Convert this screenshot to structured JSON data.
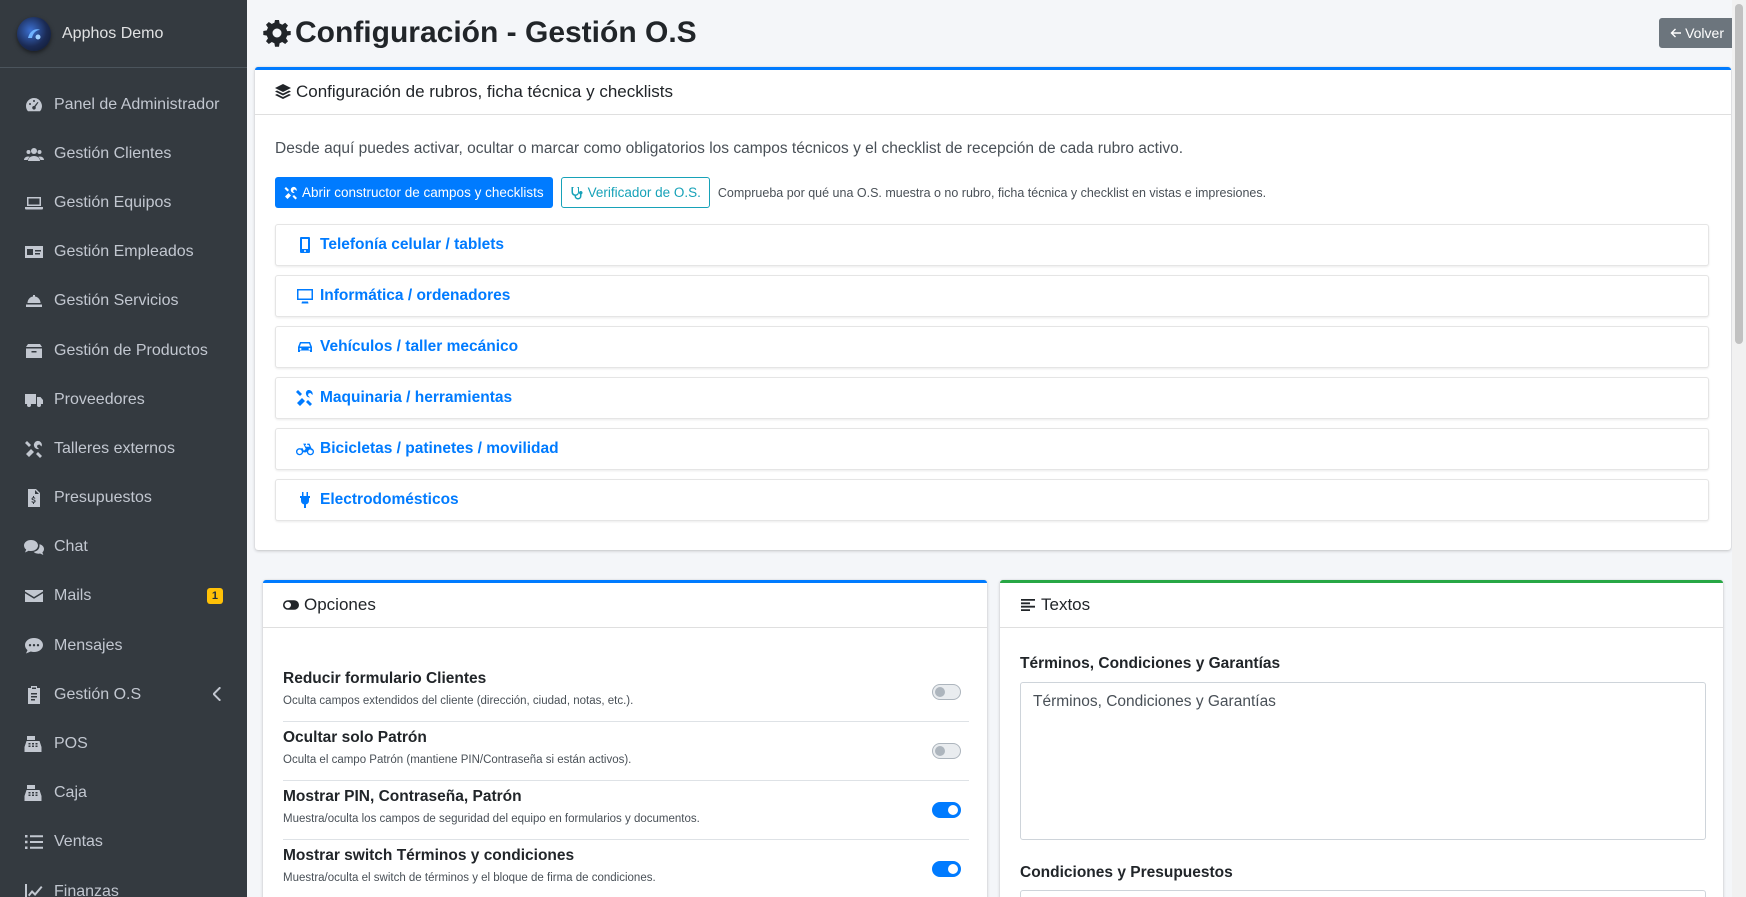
{
  "brand": {
    "name": "Apphos Demo"
  },
  "sidebar": {
    "items": [
      {
        "label": "Panel de Administrador",
        "icon": "tachometer-icon"
      },
      {
        "label": "Gestión Clientes",
        "icon": "users-icon"
      },
      {
        "label": "Gestión Equipos",
        "icon": "laptop-icon"
      },
      {
        "label": "Gestión Empleados",
        "icon": "id-card-icon"
      },
      {
        "label": "Gestión Servicios",
        "icon": "concierge-bell-icon"
      },
      {
        "label": "Gestión de Productos",
        "icon": "box-icon"
      },
      {
        "label": "Proveedores",
        "icon": "truck-icon"
      },
      {
        "label": "Talleres externos",
        "icon": "tools-icon"
      },
      {
        "label": "Presupuestos",
        "icon": "file-invoice-icon"
      },
      {
        "label": "Chat",
        "icon": "comments-icon"
      },
      {
        "label": "Mails",
        "icon": "envelope-icon",
        "badge": "1"
      },
      {
        "label": "Mensajes",
        "icon": "comment-dots-icon"
      },
      {
        "label": "Gestión O.S",
        "icon": "clipboard-icon",
        "expandable": true
      },
      {
        "label": "POS",
        "icon": "cash-register-icon"
      },
      {
        "label": "Caja",
        "icon": "cash-register-icon"
      },
      {
        "label": "Ventas",
        "icon": "list-icon"
      },
      {
        "label": "Finanzas",
        "icon": "chart-line-icon"
      }
    ]
  },
  "header": {
    "title": "Configuración - Gestión O.S",
    "back_label": "Volver"
  },
  "rubros_card": {
    "title": "Configuración de rubros, ficha técnica y checklists",
    "intro": "Desde aquí puedes activar, ocultar o marcar como obligatorios los campos técnicos y el checklist de recepción de cada rubro activo.",
    "builder_button": "Abrir constructor de campos y checklists",
    "verifier_button": "Verificador de O.S.",
    "hint": "Comprueba por qué una O.S. muestra o no rubro, ficha técnica y checklist en vistas e impresiones.",
    "rubros": [
      {
        "label": "Telefonía celular / tablets",
        "icon": "mobile-icon"
      },
      {
        "label": "Informática / ordenadores",
        "icon": "desktop-icon"
      },
      {
        "label": "Vehículos / taller mecánico",
        "icon": "car-icon"
      },
      {
        "label": "Maquinaria / herramientas",
        "icon": "tools-icon"
      },
      {
        "label": "Bicicletas / patinetes / movilidad",
        "icon": "bicycle-icon"
      },
      {
        "label": "Electrodomésticos",
        "icon": "plug-icon"
      }
    ]
  },
  "options_card": {
    "title": "Opciones",
    "options": [
      {
        "title": "Reducir formulario Clientes",
        "desc": "Oculta campos extendidos del cliente (dirección, ciudad, notas, etc.).",
        "enabled": false
      },
      {
        "title": "Ocultar solo Patrón",
        "desc": "Oculta el campo Patrón (mantiene PIN/Contraseña si están activos).",
        "enabled": false
      },
      {
        "title": "Mostrar PIN, Contraseña, Patrón",
        "desc": "Muestra/oculta los campos de seguridad del equipo en formularios y documentos.",
        "enabled": true
      },
      {
        "title": "Mostrar switch Términos y condiciones",
        "desc": "Muestra/oculta el switch de términos y el bloque de firma de condiciones.",
        "enabled": true
      }
    ]
  },
  "texts_card": {
    "title": "Textos",
    "terms_label": "Términos, Condiciones y Garantías",
    "terms_value": "Términos, Condiciones y Garantías",
    "budget_label": "Condiciones y Presupuestos"
  },
  "colors": {
    "primary": "#007bff",
    "success": "#28a745",
    "sidebar": "#343a40",
    "warning": "#ffc107",
    "secondary": "#6c757d",
    "info": "#17a2b8"
  }
}
